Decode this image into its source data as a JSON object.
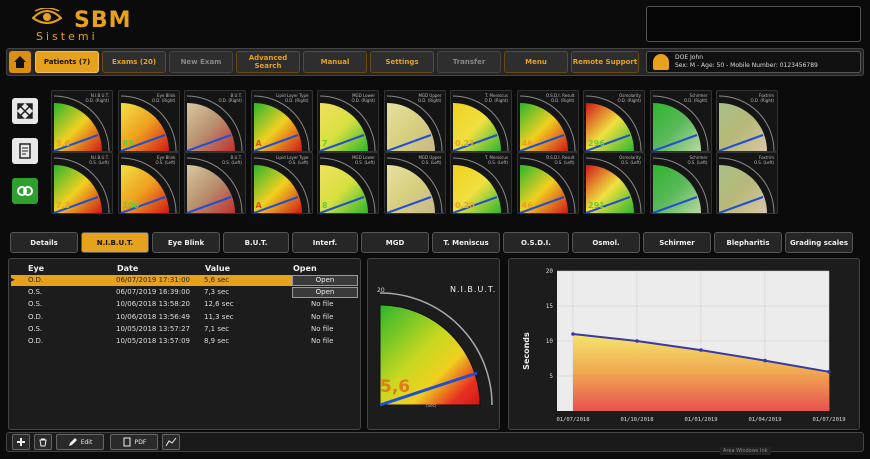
{
  "app": {
    "brand": "SBM",
    "subtitle": "Sistemi"
  },
  "toolbar": {
    "buttons": [
      "Patients (7)",
      "Exams (20)",
      "New Exam",
      "Advanced Search",
      "Manual",
      "Settings",
      "Transfer",
      "Menu",
      "Remote Support"
    ]
  },
  "patient": {
    "name": "DOE John",
    "info": "Sex: M - Age: 50 - Mobile Number: 0123456789"
  },
  "gauges": {
    "row1": [
      {
        "label": "N.I.B.U.T.\nO.D. (Right)",
        "value": "5,6",
        "value_color": "#e6a21d",
        "style": "rg"
      },
      {
        "label": "Eye Blink\nO.D. (Right)",
        "value": "88",
        "value_color": "#66cc33",
        "style": "yr"
      },
      {
        "label": "B.U.T.\nO.D. (Right)",
        "value": "",
        "value_color": "#e6a21d",
        "style": "br"
      },
      {
        "label": "Lipid Layer Type\nO.D. (Right)",
        "value": "A",
        "value_color": "#e64a1d",
        "style": "rg"
      },
      {
        "label": "MGD Lower\nO.D. (Right)",
        "value": "7",
        "value_color": "#66cc33",
        "style": "gy"
      },
      {
        "label": "MGD Upper\nO.D. (Right)",
        "value": "",
        "value_color": "#e6a21d",
        "style": "ty"
      },
      {
        "label": "T. Meniscus\nO.D. (Right)",
        "value": "0,21",
        "value_color": "#e6a21d",
        "style": "yg"
      },
      {
        "label": "O.S.D.I. Result\nO.D. (Right)",
        "value": "46",
        "value_color": "#e6a21d",
        "style": "rg"
      },
      {
        "label": "Osmolarity\nO.D. (Right)",
        "value": "296",
        "value_color": "#66cc33",
        "style": "rr"
      },
      {
        "label": "Schirmer\nO.D. (Right)",
        "value": "",
        "value_color": "#e6a21d",
        "style": "gg"
      },
      {
        "label": "Foxtrim\nO.D. (Right)",
        "value": "",
        "value_color": "#e6a21d",
        "style": "tt"
      }
    ],
    "row2": [
      {
        "label": "N.I.B.U.T.\nO.S. (Left)",
        "value": "7,3",
        "value_color": "#e6a21d",
        "style": "rg"
      },
      {
        "label": "Eye Blink\nO.S. (Left)",
        "value": "100",
        "value_color": "#66cc33",
        "style": "yr"
      },
      {
        "label": "B.U.T.\nO.S. (Left)",
        "value": "",
        "value_color": "#e6a21d",
        "style": "br"
      },
      {
        "label": "Lipid Layer Type\nO.S. (Left)",
        "value": "A",
        "value_color": "#e64a1d",
        "style": "rg"
      },
      {
        "label": "MGD Lower\nO.S. (Left)",
        "value": "8",
        "value_color": "#66cc33",
        "style": "gy"
      },
      {
        "label": "MGD Upper\nO.S. (Left)",
        "value": "",
        "value_color": "#e6a21d",
        "style": "ty"
      },
      {
        "label": "T. Meniscus\nO.S. (Left)",
        "value": "0,20",
        "value_color": "#e6a21d",
        "style": "yg"
      },
      {
        "label": "O.S.D.I. Result\nO.S. (Left)",
        "value": "46",
        "value_color": "#e6a21d",
        "style": "rg"
      },
      {
        "label": "Osmolarity\nO.S. (Left)",
        "value": "291",
        "value_color": "#66cc33",
        "style": "rr"
      },
      {
        "label": "Schirmer\nO.S. (Left)",
        "value": "",
        "value_color": "#e6a21d",
        "style": "gg"
      },
      {
        "label": "Foxtrim\nO.S. (Left)",
        "value": "",
        "value_color": "#e6a21d",
        "style": "tt"
      }
    ]
  },
  "tabs": [
    "Details",
    "N.I.B.U.T.",
    "Eye Blink",
    "B.U.T.",
    "Interf.",
    "MGD",
    "T. Meniscus",
    "O.S.D.I.",
    "Osmol.",
    "Schirmer",
    "Blepharitis",
    "Grading scales"
  ],
  "active_tab": 1,
  "table": {
    "headers": [
      "Eye",
      "Date",
      "Value",
      "Open"
    ],
    "rows": [
      {
        "eye": "O.D.",
        "date": "06/07/2019 17:31:00",
        "value": "5,6 sec",
        "open": "Open",
        "selected": true
      },
      {
        "eye": "O.S.",
        "date": "06/07/2019 16:39:00",
        "value": "7,3 sec",
        "open": "Open",
        "selected": false
      },
      {
        "eye": "O.S.",
        "date": "10/06/2018 13:58:20",
        "value": "12,6 sec",
        "open": "No file",
        "selected": false
      },
      {
        "eye": "O.D.",
        "date": "10/06/2018 13:56:49",
        "value": "11,3 sec",
        "open": "No file",
        "selected": false
      },
      {
        "eye": "O.S.",
        "date": "10/05/2018 13:57:27",
        "value": "7,1 sec",
        "open": "No file",
        "selected": false
      },
      {
        "eye": "O.D.",
        "date": "10/05/2018 13:57:09",
        "value": "8,9 sec",
        "open": "No file",
        "selected": false
      }
    ]
  },
  "big_gauge": {
    "title": "N.I.B.U.T.",
    "value": "5,6",
    "scale_max": "20",
    "unit": "(Sec)"
  },
  "chart_data": {
    "type": "area",
    "ylabel": "Seconds",
    "ylim": [
      0,
      20
    ],
    "yticks": [
      "20",
      "15",
      "10",
      "5"
    ],
    "x": [
      "01/07/2018",
      "01/10/2018",
      "01/01/2019",
      "01/04/2019",
      "01/07/2019"
    ],
    "series": [
      {
        "values": [
          11.0,
          10.0,
          8.7,
          7.2,
          5.6
        ]
      }
    ]
  },
  "bottom": {
    "edit": "Edit",
    "pdf": "PDF"
  },
  "watermark": "Area Windows Ink"
}
